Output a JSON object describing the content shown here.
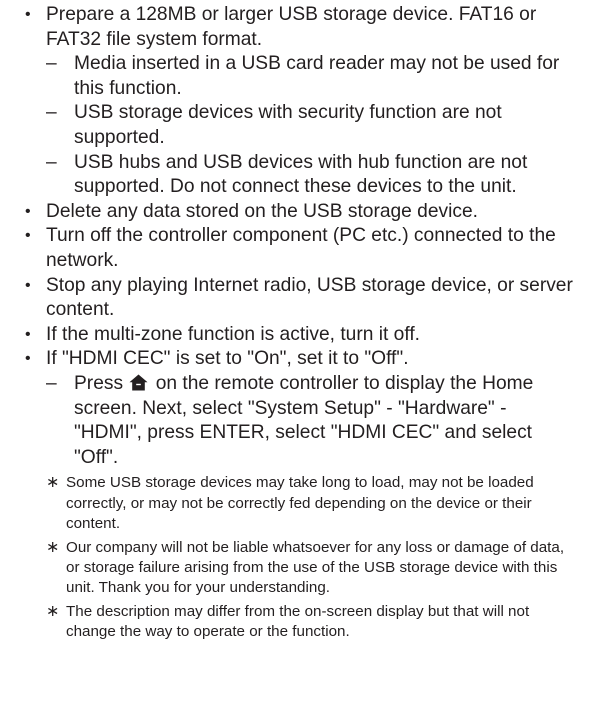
{
  "bullets": [
    {
      "text": "Prepare a 128MB or larger USB storage device. FAT16 or FAT32 file system format.",
      "subitems": [
        "Media inserted in a USB card reader may not be used for this function.",
        "USB storage devices with security function are not supported.",
        "USB hubs and USB devices with hub function are not supported. Do not connect these devices to the unit."
      ]
    },
    {
      "text": "Delete any data stored on the USB storage device."
    },
    {
      "text": "Turn off the controller component (PC etc.) connected to the network."
    },
    {
      "text": "Stop any playing Internet radio, USB storage device, or server content."
    },
    {
      "text": "If the multi-zone function is active, turn it off."
    },
    {
      "text": "If \"HDMI CEC\" is set to \"On\", set it to \"Off\".",
      "home_instruction": {
        "before_icon": "Press",
        "icon": "home-icon",
        "after_icon": "on the remote controller to display the Home screen. Next, select \"System Setup\" - \"Hardware\" - \"HDMI\", press ENTER, select \"HDMI CEC\" and select \"Off\"."
      },
      "notes": [
        "Some USB storage devices may take long to load, may not be loaded correctly, or may not be correctly fed depending on the device or their content.",
        "Our company will not be liable whatsoever for any loss or damage of data, or storage failure arising from the use of the USB storage device with this unit. Thank you for your understanding.",
        "The description may differ from the on-screen display but that will not change the way to operate or the function."
      ]
    }
  ],
  "markers": {
    "bullet": "•",
    "dash": "–",
    "note": "∗"
  },
  "colors": {
    "text": "#231f20",
    "background": "#ffffff"
  }
}
